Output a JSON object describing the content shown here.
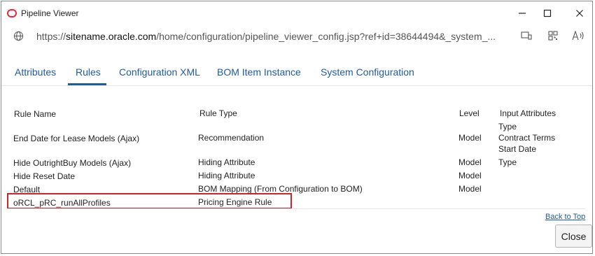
{
  "window": {
    "title": "Pipeline Viewer",
    "controls": {
      "minimize": "—",
      "maximize": "☐",
      "close": "✕"
    }
  },
  "address": {
    "prefix": "https://",
    "host": "sitename.oracle.com",
    "path": "/home/configuration/pipeline_viewer_config.jsp?ref+id=38644494&_system_..."
  },
  "tabs": [
    {
      "label": "Attributes"
    },
    {
      "label": "Rules",
      "active": true
    },
    {
      "label": "Configuration XML"
    },
    {
      "label": "BOM Item Instance"
    },
    {
      "label": "System Configuration"
    }
  ],
  "table": {
    "headers": {
      "rule_name": "Rule Name",
      "rule_type": "Rule Type",
      "level": "Level",
      "input_attributes": "Input Attributes"
    },
    "rows": [
      {
        "name": "End Date for Lease Models (Ajax)",
        "type": "Recommendation",
        "level": "Model",
        "inputs": [
          "Type",
          "Contract Terms",
          "Start Date"
        ]
      },
      {
        "name": "Hide OutrightBuy Models (Ajax)",
        "type": "Hiding Attribute",
        "level": "Model",
        "inputs": [
          "Type"
        ]
      },
      {
        "name": "Hide Reset Date",
        "type": "Hiding Attribute",
        "level": "Model",
        "inputs": []
      },
      {
        "name": "Default",
        "type": "BOM Mapping (From Configuration to BOM)",
        "level": "Model",
        "inputs": []
      },
      {
        "name": "oRCL_pRC_runAllProfiles",
        "type": "Pricing Engine Rule",
        "level": "",
        "inputs": [],
        "highlighted": true
      }
    ]
  },
  "footer": {
    "back_to_top": "Back to Top",
    "close_label": "Close"
  },
  "colors": {
    "link": "#1f5ba3",
    "highlight_border": "#d2232a",
    "logo": "#e8283b"
  }
}
